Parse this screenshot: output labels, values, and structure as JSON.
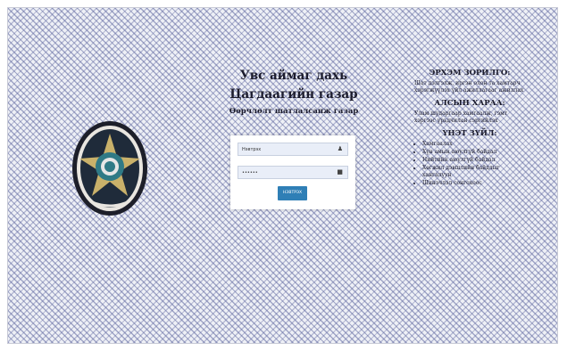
{
  "header": {
    "line1": "Увс аймаг дахь",
    "line2": "Цагдаагийн газар",
    "line3": "Өөрчлөлт шатлалсанж газар"
  },
  "login": {
    "username_value": "Нэвтрэх",
    "password_value": "••••••",
    "submit_label": "НЭВТРЭХ"
  },
  "info": {
    "mission_title": "ЭРХЭМ ЗОРИЛГО:",
    "mission_text": "Шат дэлгэлж, иргэн олон та хамтарч хэрэгжүүлэх үйл ажиллагааг ажиллах",
    "vision_title": "АЛСЫН ХАРАА:",
    "vision_text": "Улам шударгаар хамгаалж, гэмт хэргээс урьдчилан сэргийлэх",
    "values_title": "ҮНЭТ ЗҮЙЛ:",
    "values": [
      "Хамгаалах",
      "Хүн амын аюулгүй байдал",
      "Нийтийн аюулгүй байдал",
      "Хөгжил дэвшлийн байдлыг хангалуун",
      "Шинэчлэл сонгохоос"
    ]
  }
}
